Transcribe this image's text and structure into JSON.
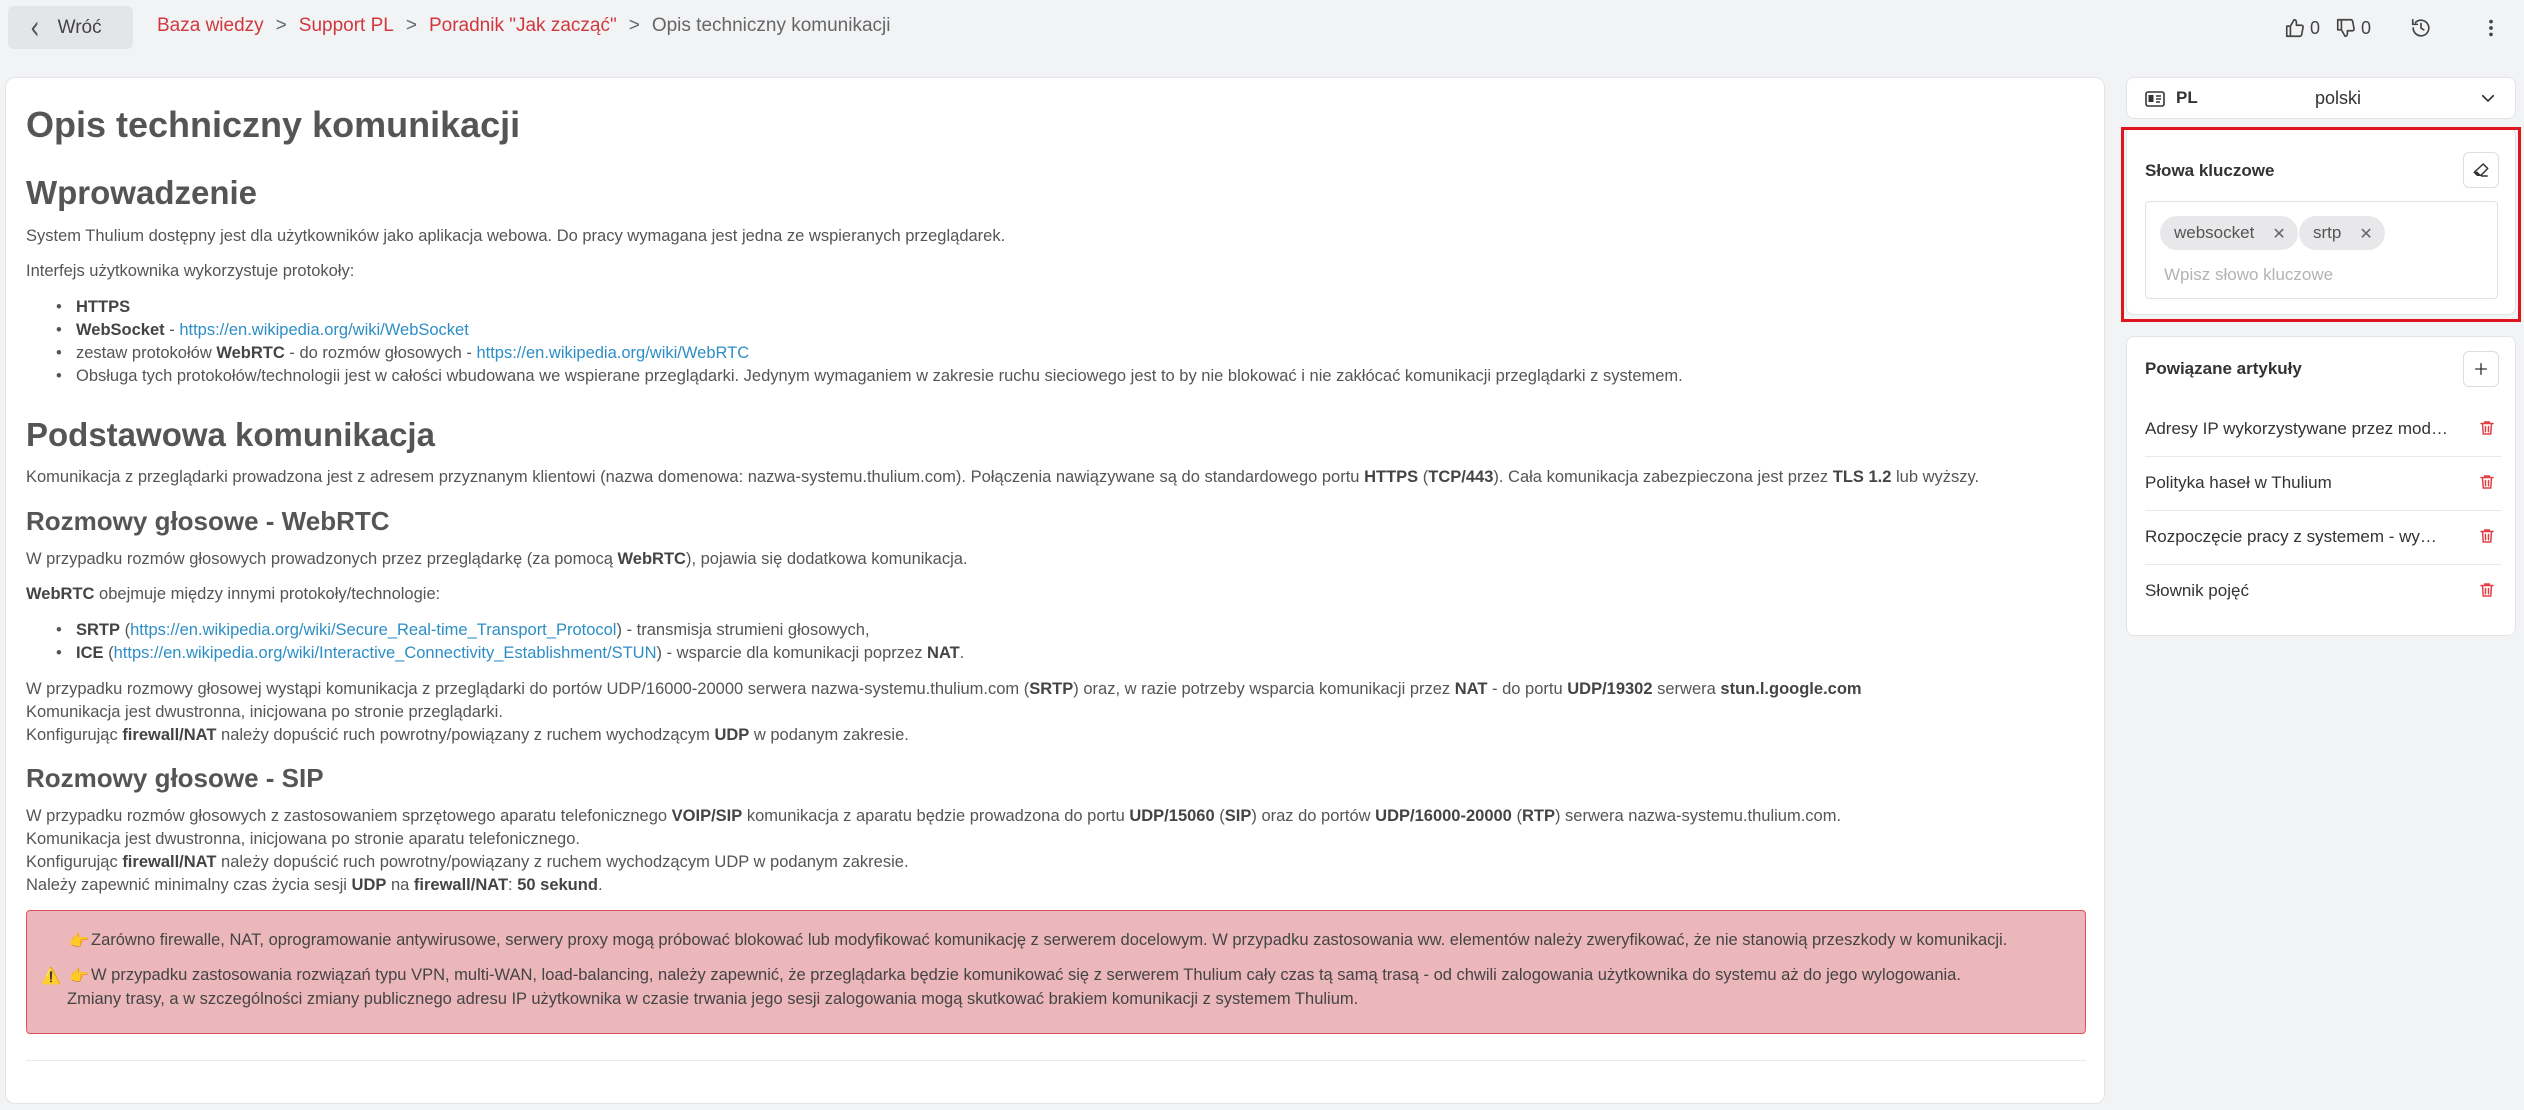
{
  "header": {
    "back_label": "Wróć",
    "breadcrumbs": [
      "Baza wiedzy",
      "Support PL",
      "Poradnik \"Jak zacząć\""
    ],
    "current": "Opis techniczny komunikacji",
    "separator": ">",
    "likes": "0",
    "dislikes": "0"
  },
  "article": {
    "title": "Opis techniczny komunikacji",
    "intro": {
      "heading": "Wprowadzenie",
      "p1": "System Thulium dostępny jest dla użytkowników jako aplikacja webowa. Do pracy wymagana jest jedna ze wspieranych przeglądarek.",
      "p2": "Interfejs użytkownika wykorzystuje protokoły:",
      "items": [
        {
          "bold": "HTTPS",
          "text": "",
          "link": ""
        },
        {
          "bold": "WebSocket",
          "text": " - ",
          "link": "https://en.wikipedia.org/wiki/WebSocket"
        },
        {
          "pre": "zestaw protokołów ",
          "bold": "WebRTC",
          "text": " - do rozmów głosowych - ",
          "link": "https://en.wikipedia.org/wiki/WebRTC"
        },
        {
          "text": "Obsługa tych protokołów/technologii jest w całości wbudowana we wspierane przeglądarki. Jedynym wymaganiem w zakresie ruchu sieciowego jest to by nie blokować i nie zakłócać komunikacji przeglądarki z systemem."
        }
      ]
    },
    "basic": {
      "heading": "Podstawowa komunikacja",
      "p1a": "Komunikacja z przeglądarki prowadzona jest z adresem przyznanym klientowi (nazwa domenowa: nazwa-systemu.thulium.com). Połączenia nawiązywane są do standardowego portu ",
      "p1b": "HTTPS",
      "p1c": " (",
      "p1d": "TCP/443",
      "p1e": "). Cała komunikacja zabezpieczona jest przez ",
      "p1f": "TLS 1.2",
      "p1g": " lub wyższy."
    },
    "webrtc": {
      "heading": "Rozmowy głosowe - WebRTC",
      "p1a": "W przypadku rozmów głosowych prowadzonych przez przeglądarkę (za pomocą ",
      "p1b": "WebRTC",
      "p1c": "), pojawia się dodatkowa komunikacja.",
      "p2a": "WebRTC",
      "p2b": " obejmuje między innymi protokoły/technologie:",
      "items": [
        {
          "bold": "SRTP",
          "pre": " (",
          "link": "https://en.wikipedia.org/wiki/Secure_Real-time_Transport_Protocol",
          "post": ") - transmisja strumieni głosowych,"
        },
        {
          "bold": "ICE",
          "pre": " (",
          "link": "https://en.wikipedia.org/wiki/Interactive_Connectivity_Establishment/STUN",
          "post": ") - wsparcie dla komunikacji poprzez ",
          "post_bold": "NAT",
          "post_end": "."
        }
      ],
      "l1a": "W przypadku rozmowy głosowej wystąpi komunikacja z przeglądarki do portów UDP/16000-20000 serwera nazwa-systemu.thulium.com (",
      "l1b": "SRTP",
      "l1c": ") oraz, w razie potrzeby wsparcia komunikacji przez ",
      "l1d": "NAT",
      "l1e": " - do portu ",
      "l1f": "UDP/19302",
      "l1g": " serwera ",
      "l1h": "stun.l.google.com",
      "l2": "Komunikacja jest dwustronna, inicjowana po stronie przeglądarki.",
      "l3a": "Konfigurując ",
      "l3b": "firewall/NAT",
      "l3c": " należy dopuścić ruch powrotny/powiązany z ruchem wychodzącym ",
      "l3d": "UDP",
      "l3e": " w podanym zakresie."
    },
    "sip": {
      "heading": "Rozmowy głosowe - SIP",
      "l1a": "W przypadku rozmów głosowych z zastosowaniem sprzętowego aparatu telefonicznego ",
      "l1b": "VOIP/SIP",
      "l1c": " komunikacja z aparatu będzie prowadzona do portu ",
      "l1d": "UDP/15060",
      "l1e": " (",
      "l1f": "SIP",
      "l1g": ") oraz do portów ",
      "l1h": "UDP/16000-20000",
      "l1i": " (",
      "l1j": "RTP",
      "l1k": ") serwera nazwa-systemu.thulium.com.",
      "l2": "Komunikacja jest dwustronna, inicjowana po stronie aparatu telefonicznego.",
      "l3a": "Konfigurując ",
      "l3b": "firewall/NAT",
      "l3c": " należy dopuścić ruch powrotny/powiązany z ruchem wychodzącym UDP w podanym zakresie.",
      "l4a": "Należy zapewnić minimalny czas życia sesji ",
      "l4b": "UDP",
      "l4c": " na ",
      "l4d": "firewall/NAT",
      "l4e": ": ",
      "l4f": "50 sekund",
      "l4g": "."
    },
    "alert": {
      "line1": "Zarówno firewalle, NAT, oprogramowanie antywirusowe, serwery proxy mogą próbować blokować lub modyfikować komunikację z serwerem docelowym. W przypadku zastosowania ww. elementów należy zweryfikować, że nie stanowią przeszkody w komunikacji.",
      "line2": "W przypadku zastosowania rozwiązań typu VPN, multi-WAN, load-balancing, należy zapewnić, że przeglądarka będzie komunikować się z serwerem Thulium cały czas tą samą trasą - od chwili zalogowania użytkownika do systemu aż do jego wylogowania.",
      "line3": "Zmiany trasy, a w szczególności zmiany publicznego adresu IP użytkownika w czasie trwania jego sesji zalogowania mogą skutkować brakiem komunikacji z systemem Thulium."
    }
  },
  "sidebar": {
    "language": {
      "code": "PL",
      "name": "polski"
    },
    "keywords": {
      "title": "Słowa kluczowe",
      "tags": [
        "websocket",
        "srtp"
      ],
      "placeholder": "Wpisz słowo kluczowe"
    },
    "related": {
      "title": "Powiązane artykuły",
      "items": [
        "Adresy IP wykorzystywane przez moduły systemu Thulium",
        "Polityka haseł w Thulium",
        "Rozpoczęcie pracy z systemem - wymagania",
        "Słownik pojęć"
      ]
    }
  },
  "colors": {
    "accent_red": "#d0383e",
    "link_blue": "#2d8ec6",
    "alert_bg": "#ebb7bb",
    "highlight": "#e0151c"
  }
}
